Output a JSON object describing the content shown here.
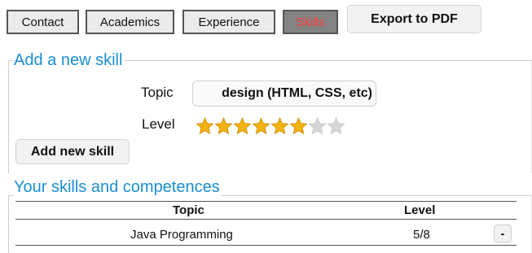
{
  "tabs": [
    {
      "label": "Contact",
      "active": false
    },
    {
      "label": "Academics",
      "active": false
    },
    {
      "label": "Experience",
      "active": false
    },
    {
      "label": "Skills",
      "active": true
    }
  ],
  "export_label": "Export to PDF",
  "add_skill": {
    "legend": "Add a new skill",
    "topic_label": "Topic",
    "topic_value": "design (HTML, CSS, etc)",
    "level_label": "Level",
    "rating": 6,
    "rating_max": 8,
    "button_label": "Add new skill"
  },
  "skills_list": {
    "legend": "Your skills and competences",
    "col_topic": "Topic",
    "col_level": "Level",
    "rows": [
      {
        "topic": "Java Programming",
        "level": "5/8",
        "remove_label": "-"
      }
    ]
  },
  "colors": {
    "accent": "#1a8fd1",
    "star_on": "#f2b20f",
    "star_off": "#d6d6d6",
    "active_tab_text": "#ff3b3b"
  }
}
